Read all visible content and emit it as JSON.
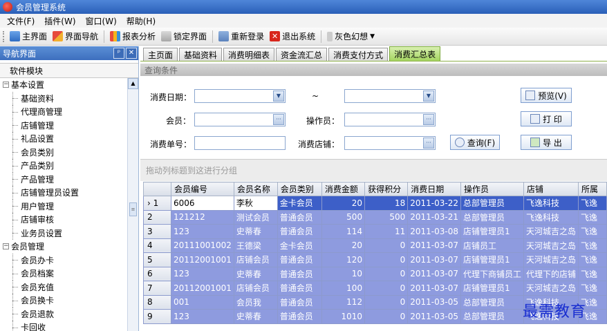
{
  "window": {
    "title": "会员管理系统"
  },
  "menu": [
    "文件(F)",
    "插件(W)",
    "窗口(W)",
    "帮助(H)"
  ],
  "toolbar": {
    "items": [
      {
        "label": "主界面",
        "icon": "home-icon"
      },
      {
        "label": "界面导航",
        "icon": "navigation-icon"
      },
      {
        "label": "报表分析",
        "icon": "report-icon"
      },
      {
        "label": "锁定界面",
        "icon": "lock-icon"
      },
      {
        "label": "重新登录",
        "icon": "relogin-icon"
      },
      {
        "label": "退出系统",
        "icon": "exit-icon"
      }
    ],
    "theme_label": "灰色幻想"
  },
  "nav": {
    "title": "导航界面",
    "pin_glyph": "ᵖ",
    "close_glyph": "✕",
    "section": "软件模块",
    "groups": [
      {
        "label": "基本设置",
        "items": [
          "基础资料",
          "代理商管理",
          "店铺管理",
          "礼品设置",
          "会员类别",
          "产品类别",
          "产品管理",
          "店铺管理员设置",
          "用户管理",
          "店铺审核",
          "业务员设置"
        ]
      },
      {
        "label": "会员管理",
        "items": [
          "会员办卡",
          "会员档案",
          "会员充值",
          "会员换卡",
          "会员退款",
          "卡回收"
        ]
      }
    ]
  },
  "tabs": [
    "主页面",
    "基础资料",
    "消费明细表",
    "资金流汇总",
    "消费支付方式",
    "消费汇总表"
  ],
  "active_tab": "消费汇总表",
  "query": {
    "title": "查询条件",
    "date_label": "消费日期：",
    "tilde": "~",
    "member_label": "会员：",
    "operator_label": "操作员：",
    "order_label": "消费单号：",
    "shop_label": "消费店铺：",
    "search_button": "查询(F)",
    "preview_button": "预览(V)",
    "print_button": "打 印",
    "export_button": "导 出"
  },
  "group_hint": "拖动列标题到这进行分组",
  "grid": {
    "columns": [
      "会员编号",
      "会员名称",
      "会员类别",
      "消费金额",
      "获得积分",
      "消费日期",
      "操作员",
      "店铺",
      "所属"
    ],
    "rows": [
      [
        "1",
        "6006",
        "李秋",
        "金卡会员",
        "20",
        "18",
        "2011-03-22",
        "总部管理员",
        "飞逸科技",
        "飞逸"
      ],
      [
        "2",
        "121212",
        "测试会员",
        "普通会员",
        "500",
        "500",
        "2011-03-21",
        "总部管理员",
        "飞逸科技",
        "飞逸"
      ],
      [
        "3",
        "123",
        "史蒂春",
        "普通会员",
        "114",
        "11",
        "2011-03-08",
        "店铺管理员1",
        "天河城吉之岛",
        "飞逸"
      ],
      [
        "4",
        "20111001002",
        "王德梁",
        "金卡会员",
        "20",
        "0",
        "2011-03-07",
        "店铺员工",
        "天河城吉之岛",
        "飞逸"
      ],
      [
        "5",
        "20112001001",
        "店铺会员",
        "普通会员",
        "120",
        "0",
        "2011-03-07",
        "店铺管理员1",
        "天河城吉之岛",
        "飞逸"
      ],
      [
        "6",
        "123",
        "史蒂春",
        "普通会员",
        "10",
        "0",
        "2011-03-07",
        "代理下商铺员工",
        "代理下的店铺",
        "飞逸"
      ],
      [
        "7",
        "20112001001",
        "店铺会员",
        "普通会员",
        "100",
        "0",
        "2011-03-07",
        "店铺管理员1",
        "天河城吉之岛",
        "飞逸"
      ],
      [
        "8",
        "001",
        "会员我",
        "普通会员",
        "112",
        "0",
        "2011-03-05",
        "总部管理员",
        "飞逸科技",
        "飞逸"
      ],
      [
        "9",
        "123",
        "史蒂春",
        "普通会员",
        "1010",
        "0",
        "2011-03-05",
        "总部管理员",
        "飞逸科技",
        "飞逸"
      ]
    ],
    "current_row_marker": "›"
  },
  "watermark": "最需教育"
}
